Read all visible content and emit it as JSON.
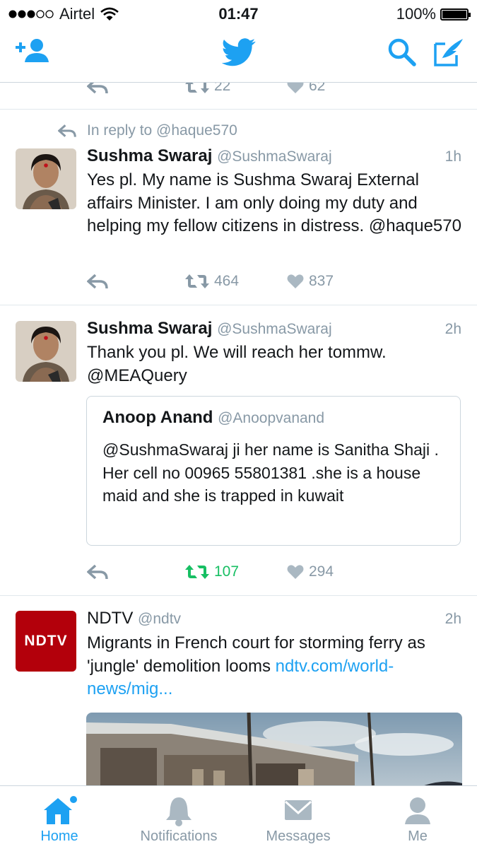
{
  "status_bar": {
    "carrier": "Airtel",
    "time": "01:47",
    "battery": "100%"
  },
  "prev_tweet": {
    "retweets": "22",
    "likes": "62"
  },
  "tweets": [
    {
      "reply_to": "In reply to @haque570",
      "name": "Sushma Swaraj",
      "handle": "@SushmaSwaraj",
      "time": "1h",
      "text": "Yes pl. My name is Sushma Swaraj External affairs Minister. I am only doing my duty and helping my fellow citizens in distress. @haque570",
      "retweets": "464",
      "likes": "837"
    },
    {
      "name": "Sushma Swaraj",
      "handle": "@SushmaSwaraj",
      "time": "2h",
      "text": "Thank you pl. We will reach her tommw. @MEAQuery",
      "quote": {
        "name": "Anoop Anand",
        "handle": "@Anoopvanand",
        "text": "@SushmaSwaraj ji her name is Sanitha Shaji . Her cell no 00965 55801381 .she is a house maid and she is trapped in kuwait"
      },
      "retweets": "107",
      "likes": "294",
      "retweeted": true
    },
    {
      "name": "NDTV",
      "handle": "@ndtv",
      "time": "2h",
      "avatar_text": "NDTV",
      "text": "Migrants in French court for storming ferry as 'jungle' demolition looms ",
      "link": "ndtv.com/world-news/mig..."
    }
  ],
  "tabs": [
    {
      "label": "Home",
      "icon": "home-icon",
      "active": true
    },
    {
      "label": "Notifications",
      "icon": "bell-icon"
    },
    {
      "label": "Messages",
      "icon": "envelope-icon"
    },
    {
      "label": "Me",
      "icon": "person-icon"
    }
  ],
  "colors": {
    "accent": "#1da1f2",
    "retweet_active": "#17bf63",
    "muted": "#8899a6",
    "ndtv_red": "#b3000b"
  }
}
